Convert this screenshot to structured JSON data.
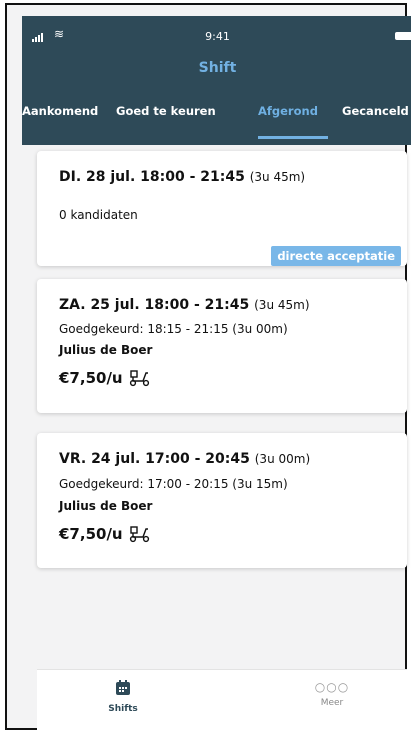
{
  "status_bar": {
    "time": "9:41"
  },
  "header": {
    "title": "Shift"
  },
  "tabs": [
    {
      "label": "Aankomend"
    },
    {
      "label": "Goed te keuren"
    },
    {
      "label": "Afgerond"
    },
    {
      "label": "Gecanceld"
    }
  ],
  "shifts": [
    {
      "date": "DI. 28 jul. 18:00 - 21:45",
      "duration": "(3u 45m)",
      "candidates": "0 kandidaten",
      "badge": "directe acceptatie"
    },
    {
      "date": "ZA. 25 jul. 18:00 - 21:45",
      "duration": "(3u 45m)",
      "approved": "Goedgekeurd: 18:15 - 21:15 (3u 00m)",
      "worker": "Julius de Boer",
      "price": "€7,50/u"
    },
    {
      "date": "VR. 24 jul. 17:00 - 20:45",
      "duration": "(3u 00m)",
      "approved": "Goedgekeurd: 17:00 - 20:15 (3u 15m)",
      "worker": "Julius de Boer",
      "price": "€7,50/u"
    }
  ],
  "bottom_nav": [
    {
      "label": "Shifts",
      "icon": "calendar-icon",
      "active": true
    },
    {
      "label": "Meer",
      "icon": "more-icon",
      "active": false
    }
  ],
  "colors": {
    "header_bg": "#2e4a58",
    "accent": "#72b1e2",
    "badge": "#79b7e8"
  }
}
